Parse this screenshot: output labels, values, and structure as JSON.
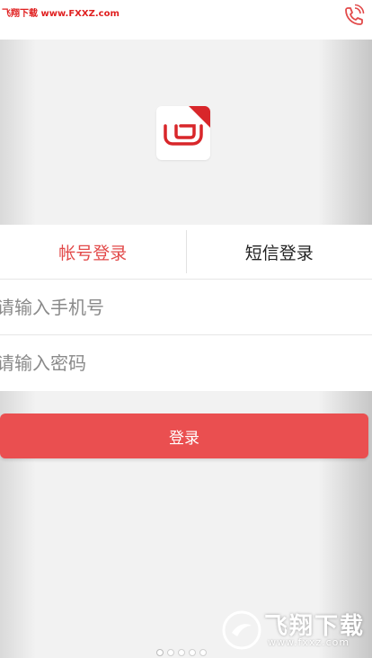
{
  "header": {
    "watermark_text": "飞翔下载 www.FXXZ.com"
  },
  "tabs": [
    {
      "label": "帐号登录",
      "active": true
    },
    {
      "label": "短信登录",
      "active": false
    }
  ],
  "form": {
    "phone_placeholder": "请输入手机号",
    "password_placeholder": "请输入密码",
    "login_label": "登录"
  },
  "pager": {
    "count": 5,
    "active_index": 0
  },
  "bottom_watermark": {
    "title": "飞翔下载",
    "url": "www.fxxz.com"
  },
  "colors": {
    "accent": "#ea4f50",
    "active_tab": "#e24a4a"
  },
  "icons": {
    "top_right": "phone-call-icon",
    "left_arrow": "chevron-left-icon",
    "right_arrow": "chevron-right-icon"
  }
}
